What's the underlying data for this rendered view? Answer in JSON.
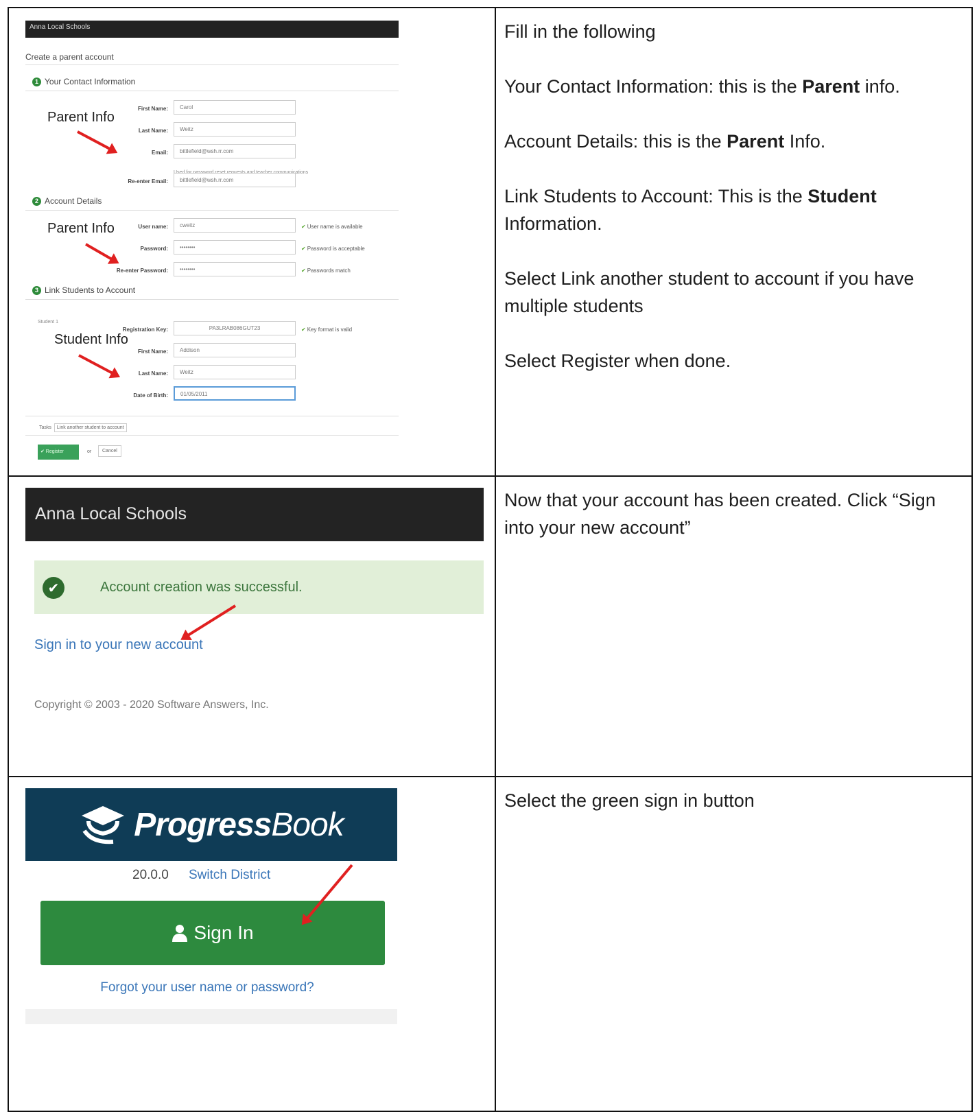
{
  "row1": {
    "form": {
      "app_title": "Anna Local Schools",
      "page_title": "Create a parent account",
      "section1": {
        "num": "1",
        "title": "Your Contact Information"
      },
      "section2": {
        "num": "2",
        "title": "Account Details"
      },
      "section3": {
        "num": "3",
        "title": "Link Students to Account"
      },
      "fields": {
        "first_name": {
          "label": "First Name:",
          "value": "Carol"
        },
        "last_name": {
          "label": "Last Name:",
          "value": "Weitz"
        },
        "email": {
          "label": "Email:",
          "value": "bittlefield@wsh.rr.com"
        },
        "email_note": "Used for password reset requests and teacher communications",
        "reenter_email": {
          "label": "Re-enter Email:",
          "value": "bittlefield@wsh.rr.com"
        },
        "username": {
          "label": "User name:",
          "value": "cweitz",
          "status": "User name is available"
        },
        "password": {
          "label": "Password:",
          "value": "••••••••",
          "status": "Password is acceptable"
        },
        "reenter_password": {
          "label": "Re-enter Password:",
          "value": "••••••••",
          "status": "Passwords match"
        },
        "student_label": "Student 1",
        "reg_key": {
          "label": "Registration Key:",
          "value": "PA3LRAB086GUT23",
          "status": "Key format is valid"
        },
        "stu_first": {
          "label": "First Name:",
          "value": "Addison"
        },
        "stu_last": {
          "label": "Last Name:",
          "value": "Weitz"
        },
        "dob": {
          "label": "Date of Birth:",
          "value": "01/05/2011"
        }
      },
      "link_prefix": "Tasks",
      "link_label": "Link another student to account",
      "register_label": "✔ Register",
      "or_label": "or",
      "cancel_label": "Cancel",
      "annotations": {
        "parent1": "Parent Info",
        "parent2": "Parent Info",
        "student": "Student Info"
      }
    },
    "text": {
      "p1": "Fill in the following",
      "p2_pre": "Your Contact Information:  this is the ",
      "p2_bold": "Parent",
      "p2_post": " info.",
      "p3_pre": "Account Details:  this is the ",
      "p3_bold": "Parent",
      "p3_post": " Info.",
      "p4_pre": "Link Students to Account:  This is the ",
      "p4_bold": "Student",
      "p4_post": " Information.",
      "p5": "Select Link another student to account if you have multiple students",
      "p6": "Select Register when done."
    }
  },
  "row2": {
    "shot": {
      "header": "Anna Local Schools",
      "success_icon": "✔",
      "success_msg": "Account creation was successful.",
      "sign_in_link": "Sign in to your new account",
      "copyright": "Copyright © 2003 - 2020 Software Answers, Inc."
    },
    "text": {
      "p1": "Now that your account has been created. Click “Sign into your new account”"
    }
  },
  "row3": {
    "shot": {
      "logo_bold": "Progress",
      "logo_light": "Book",
      "logo_icon": "graduation-cap-icon",
      "version": "20.0.0",
      "switch_district": "Switch District",
      "sign_in": "Sign In",
      "user_icon": "user-icon",
      "forgot": "Forgot your user name or password?"
    },
    "text": {
      "p1": "Select the green sign in button"
    }
  },
  "colors": {
    "green": "#2d8a3e",
    "link_blue": "#3a76b8",
    "arrow_red": "#e02020",
    "navy": "#0f3c56"
  }
}
